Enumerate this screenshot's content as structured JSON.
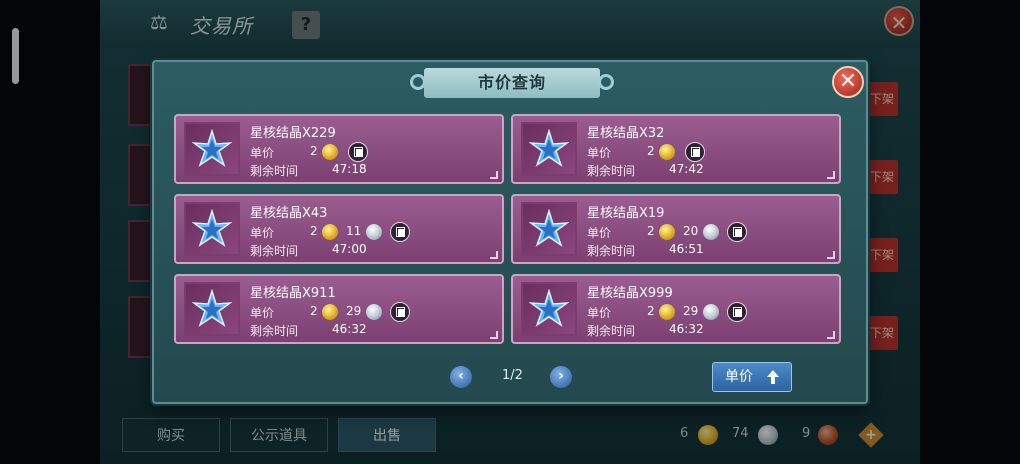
{
  "background": {
    "title": "交易所",
    "help_label": "?",
    "close_label": "✕",
    "unlist_label": "下架",
    "tabs": [
      {
        "label": "购买",
        "active": false
      },
      {
        "label": "公示道具",
        "active": false
      },
      {
        "label": "出售",
        "active": true
      }
    ],
    "currencies": [
      {
        "amount": "6",
        "icon": "gold-coin-icon"
      },
      {
        "amount": "74",
        "icon": "silver-coin-icon"
      },
      {
        "amount": "9",
        "icon": "copper-coin-icon"
      }
    ]
  },
  "modal": {
    "title": "市价查询",
    "close_label": "✕",
    "price_label": "单价",
    "time_label": "剩余时间",
    "listings": [
      {
        "name": "星核结晶X229",
        "gold": "2",
        "silver": "",
        "time": "47:18"
      },
      {
        "name": "星核结晶X32",
        "gold": "2",
        "silver": "",
        "time": "47:42"
      },
      {
        "name": "星核结晶X43",
        "gold": "2",
        "silver": "11",
        "time": "47:00"
      },
      {
        "name": "星核结晶X19",
        "gold": "2",
        "silver": "20",
        "time": "46:51"
      },
      {
        "name": "星核结晶X911",
        "gold": "2",
        "silver": "29",
        "time": "46:32"
      },
      {
        "name": "星核结晶X999",
        "gold": "2",
        "silver": "29",
        "time": "46:32"
      }
    ],
    "pagination": {
      "prev": "‹",
      "page": "1/2",
      "next": "›"
    },
    "sort_button": "单价"
  },
  "colors": {
    "card_bg": "#8a4f80",
    "modal_bg": "#2c5c62",
    "accent_blue": "#3d77b5",
    "close_red": "#c8382c"
  }
}
